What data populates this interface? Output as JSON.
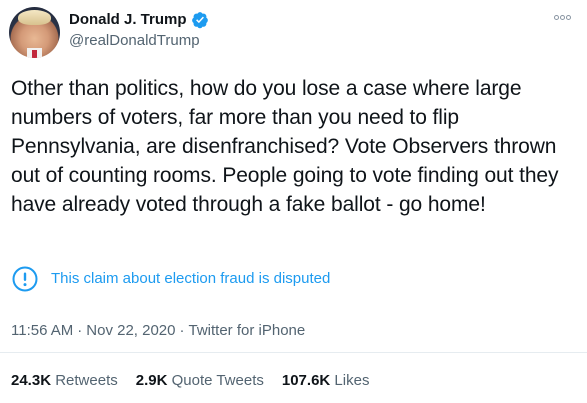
{
  "author": {
    "display_name": "Donald J. Trump",
    "handle": "@realDonaldTrump"
  },
  "tweet": {
    "text": "Other than politics, how do you lose a case where large numbers of voters, far more than you need to flip Pennsylvania, are disenfranchised? Vote Observers thrown out of counting rooms. People going to vote finding out they have already voted through a fake ballot - go home!",
    "notice": "This claim about election fraud is disputed",
    "time": "11:56 AM",
    "date": "Nov 22, 2020",
    "separator": "·",
    "source": "Twitter for iPhone"
  },
  "stats": {
    "retweets_count": "24.3K",
    "retweets_label": "Retweets",
    "quotes_count": "2.9K",
    "quotes_label": "Quote Tweets",
    "likes_count": "107.6K",
    "likes_label": "Likes"
  },
  "colors": {
    "accent": "#1d9bf0",
    "text_primary": "#0f1419",
    "text_secondary": "#536471"
  },
  "icons": {
    "verified": "verified-badge-icon",
    "more": "more-options-icon",
    "notice": "exclamation-circle-icon"
  }
}
